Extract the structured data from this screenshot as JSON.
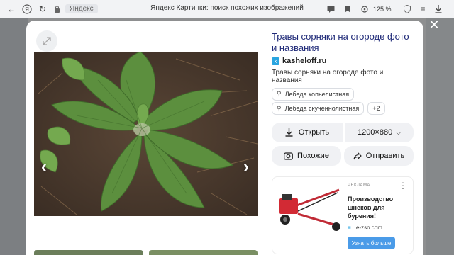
{
  "browser": {
    "domain_chip": "Яндекс",
    "tab_title": "Яндекс Картинки: поиск похожих изображений",
    "zoom_level": "125 %"
  },
  "viewer": {
    "title": "Травы сорняки на огороде фото и названия",
    "source_name": "kasheloff.ru",
    "description": "Травы сорняки на огороде фото и названия",
    "tags": [
      {
        "label": "Лебеда копьелистная"
      },
      {
        "label": "Лебеда скученнолистная"
      }
    ],
    "more_tags": "+2",
    "open_label": "Открыть",
    "size_label": "1200×880",
    "similar_label": "Похожие",
    "share_label": "Отправить"
  },
  "ad": {
    "label": "РЕКЛАМА",
    "text": "Производство шнеков для бурения!",
    "domain": "e-zso.com",
    "button_label": "Узнать больше"
  },
  "colors": {
    "title_link": "#1f2a78",
    "source_logo": "#2aa5e0",
    "ad_button": "#4a9be8",
    "button_bg": "#f0f1f4"
  }
}
